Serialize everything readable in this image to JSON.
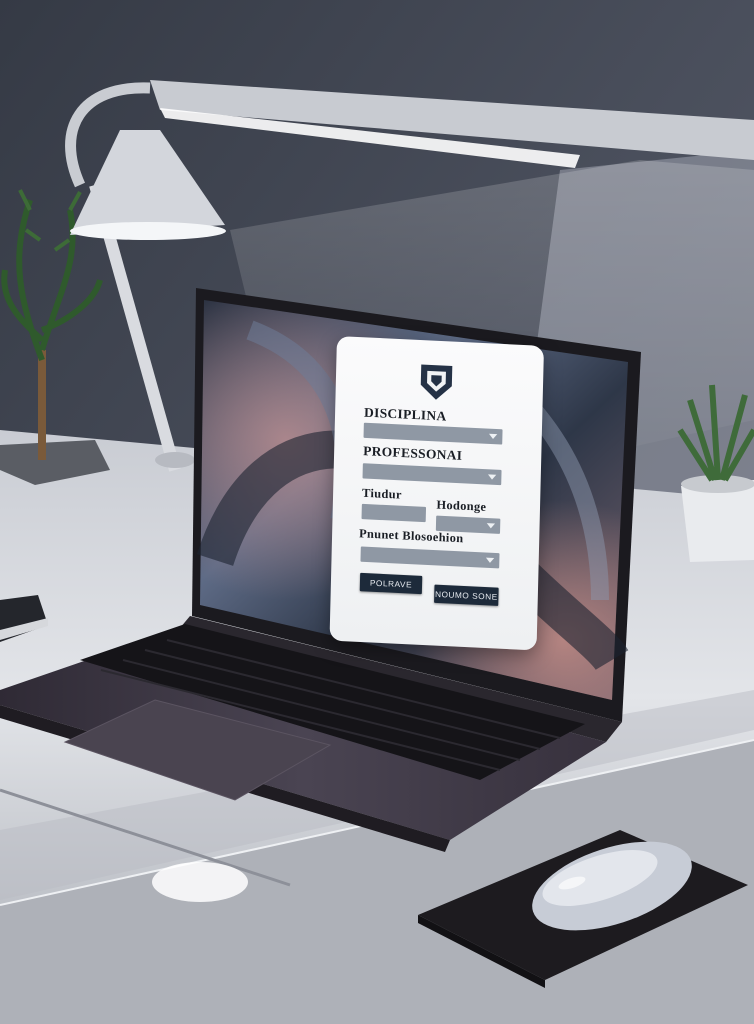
{
  "form": {
    "title": "DISCIPLINA",
    "title_field": "",
    "professional_label": "PROFESSONAI",
    "professional_field": "",
    "left_label": "Tiudur",
    "left_field": "",
    "right_label": "Hodonge",
    "right_field": "",
    "project_label": "Pnunet Blosoehion",
    "project_field": "",
    "left_button": "POLRAVE",
    "right_button": "NOUMO SONE"
  },
  "colors": {
    "wall": "#3f4450",
    "desk": "#dfe2e7",
    "laptop": "#3a3540",
    "form_button": "#1d2a3a",
    "form_field": "#8f98a4"
  },
  "icons": [
    "shield-logo-icon",
    "dropdown-caret-icon"
  ]
}
